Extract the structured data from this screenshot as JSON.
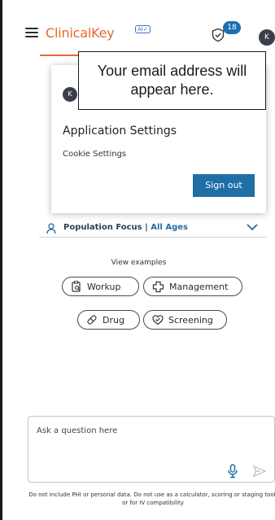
{
  "header": {
    "logo_text": "ClinicalKey",
    "ai_badge": "AI✓",
    "notification_count": "18",
    "avatar_initial": "K"
  },
  "popup": {
    "email_placeholder": "Your email address will appear here.",
    "avatar_initial": "K",
    "application_settings": "Application Settings",
    "cookie_settings": "Cookie Settings",
    "sign_out": "Sign out"
  },
  "population_focus": {
    "label": "Population Focus",
    "separator": " | ",
    "value": "All Ages"
  },
  "examples": {
    "heading": "View examples",
    "chips": [
      {
        "label": "Workup",
        "icon": "clipboard-search-icon"
      },
      {
        "label": "Management",
        "icon": "medical-cross-icon"
      },
      {
        "label": "Drug",
        "icon": "pill-icon"
      },
      {
        "label": "Screening",
        "icon": "heart-check-icon"
      }
    ]
  },
  "question": {
    "placeholder": "Ask a question here"
  },
  "disclaimer": "Do not include PHI or personal data. Do not use as a calculator, scoring or staging tool, or for IV compatibility",
  "colors": {
    "brand_orange": "#e8692b",
    "primary_blue": "#1f6ea6",
    "text_dark": "#1f1f1f"
  }
}
